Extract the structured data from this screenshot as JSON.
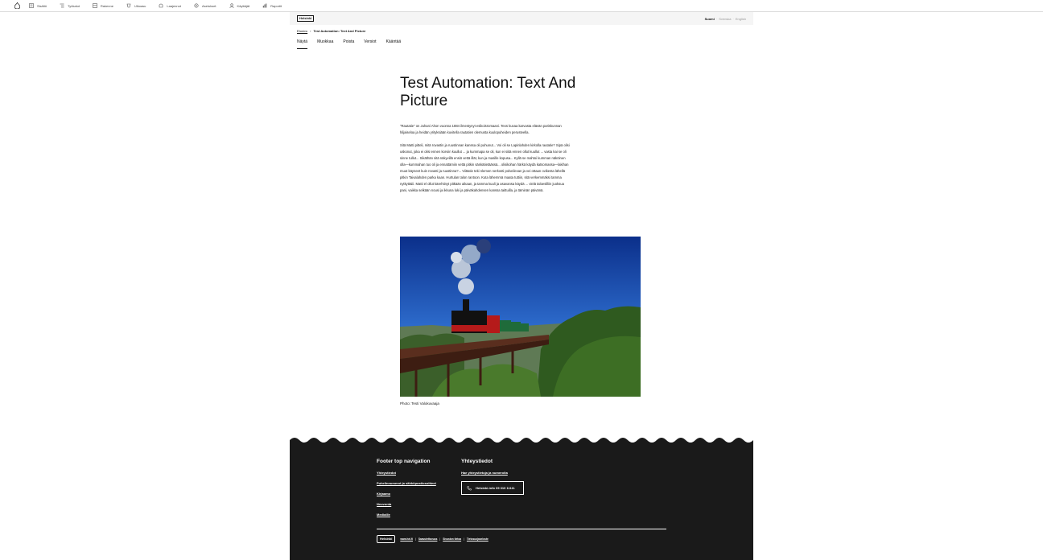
{
  "admin_toolbar": {
    "items": [
      {
        "label": "Sisältö",
        "icon": "content-icon"
      },
      {
        "label": "Työkalut",
        "icon": "tools-icon"
      },
      {
        "label": "Rakenne",
        "icon": "structure-icon"
      },
      {
        "label": "Ulkoasu",
        "icon": "appearance-icon"
      },
      {
        "label": "Laajennot",
        "icon": "extend-icon"
      },
      {
        "label": "Asetukset",
        "icon": "config-icon"
      },
      {
        "label": "Käyttäjät",
        "icon": "people-icon"
      },
      {
        "label": "Raportit",
        "icon": "reports-icon"
      }
    ]
  },
  "header": {
    "logo": "Helsinki",
    "languages": [
      "Suomi",
      "Svenska",
      "English"
    ],
    "active_language": "Suomi"
  },
  "breadcrumb": {
    "home": "Etusivu",
    "separator": "›",
    "current": "Test Automation: Text And Picture"
  },
  "tabs": [
    "Näytä",
    "Muokkaa",
    "Poista",
    "Versiot",
    "Kääntää"
  ],
  "article": {
    "title": "Test Automation: Text And Picture",
    "paragraphs": [
      "\"Rautatie\" on Juhani Ahon vuonna 1884 ilmestynyt esikoisromaani. Teos kuvaa karvasta elävän pariskunnan hiljaiseloa ja heidän yrityksiään kuvitella rautatien olemusta kuulopuheiden perusteella.",
      "Sitä Matti pitteli, mitä rovastin ja ruustinnan kanssa oli puhunut... Voi oli se Lapinlahden kirkolla rautatie? Sipä olisi uskonut, joka ei olisi ennen korviin kuullut ... ja kummapa se oli, kun ei siitä ennen ollut kuullut ... vasta kai se oli sinne tullut... Sikäthän sitä näkyvillä ensiö vettä illät, kun ja masille kopusa... Kyllä se mahtoi kumman näköinen olla—kummahan tuo oli ja ennattämiin vettä pitkin sänkätietäässä... olisikohan härkä käydä katsomassa—lakihan muut käyneet kuin rovasti ja ruustinna?... Viittatie teki nlemen nerkosti polveilevan ja vei ottaan ovikesta lähellä pitkin Taivalahden parka kaan. Hurtulan talon rantoon. Kuta lähemmä maata tuttiin, sitä verkemmäksi tamma nytkyttäiii. Matti el ollut kärehtinyt pitkään aikaan, ja tamma kuuli ja asavansa käydä ... vielä taloesilliin juoksua pani, vaikka selkään nousi ja ikkuna luki ja päiväkahdensen kanssa taittuilla, ja täminän päivänä."
    ],
    "photo_caption": "Photo: Testi Valokuvaaja"
  },
  "footer": {
    "nav_title": "Footer top navigation",
    "nav_links": [
      "Yhteystiedot",
      "Puhelinnumerot ja sähköpostiosoitteet",
      "Kirjaamo",
      "Neuvonta",
      "Mediaille"
    ],
    "contact_title": "Yhteystiedot",
    "contact_link": "Hae yhteystietoja ja numeroita",
    "phone_label": "Helsinki-info 09 310 11111",
    "logo": "Helsinki",
    "bottom_links": [
      "www.hel.fi",
      "Saavutettavuus",
      "Sivuston tietoa",
      "Tietosuojaseloste"
    ]
  },
  "colors": {
    "footer_bg": "#1a1a1a",
    "header_bg": "#f5f5f5"
  }
}
